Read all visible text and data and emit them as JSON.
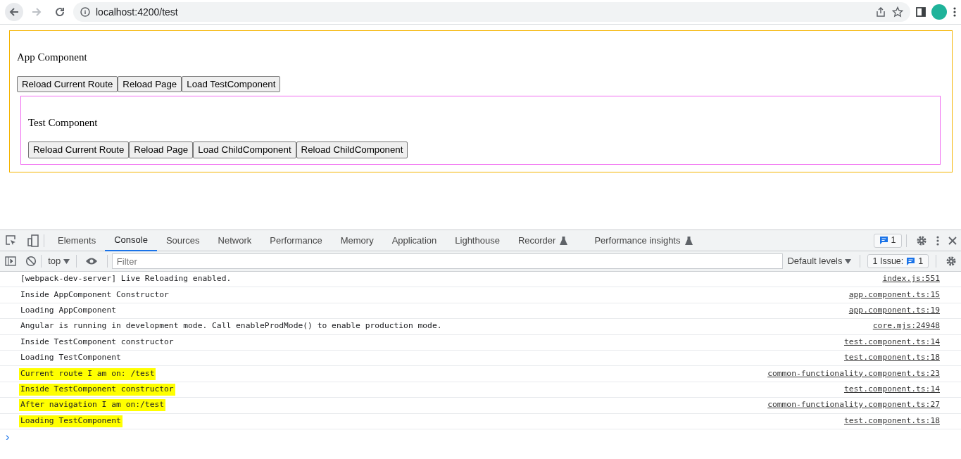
{
  "browser": {
    "url": "localhost:4200/test"
  },
  "app": {
    "title": "App Component",
    "buttons": [
      "Reload Current Route",
      "Reload Page",
      "Load TestComponent"
    ],
    "test": {
      "title": "Test Component",
      "buttons": [
        "Reload Current Route",
        "Reload Page",
        "Load ChildComponent",
        "Reload ChildComponent"
      ]
    }
  },
  "devtools": {
    "tabs": [
      {
        "label": "Elements",
        "selected": false,
        "experimental": false
      },
      {
        "label": "Console",
        "selected": true,
        "experimental": false
      },
      {
        "label": "Sources",
        "selected": false,
        "experimental": false
      },
      {
        "label": "Network",
        "selected": false,
        "experimental": false
      },
      {
        "label": "Performance",
        "selected": false,
        "experimental": false
      },
      {
        "label": "Memory",
        "selected": false,
        "experimental": false
      },
      {
        "label": "Application",
        "selected": false,
        "experimental": false
      },
      {
        "label": "Lighthouse",
        "selected": false,
        "experimental": false
      },
      {
        "label": "Recorder",
        "selected": false,
        "experimental": true
      },
      {
        "label": "Performance insights",
        "selected": false,
        "experimental": true
      }
    ],
    "messages_count": "1",
    "toolbar": {
      "context": "top",
      "filter_placeholder": "Filter",
      "levels": "Default levels",
      "issues_label": "1 Issue:",
      "issues_count": "1"
    },
    "rows": [
      {
        "message": "[webpack-dev-server] Live Reloading enabled.",
        "source": "index.js:551",
        "highlighted": false
      },
      {
        "message": "Inside AppComponent Constructor",
        "source": "app.component.ts:15",
        "highlighted": false
      },
      {
        "message": "Loading AppComponent",
        "source": "app.component.ts:19",
        "highlighted": false
      },
      {
        "message": "Angular is running in development mode. Call enableProdMode() to enable production mode.",
        "source": "core.mjs:24948",
        "highlighted": false
      },
      {
        "message": "Inside TestComponent constructor",
        "source": "test.component.ts:14",
        "highlighted": false
      },
      {
        "message": "Loading TestComponent",
        "source": "test.component.ts:18",
        "highlighted": false
      },
      {
        "message": "Current route I am on: /test",
        "source": "common-functionality.component.ts:23",
        "highlighted": true
      },
      {
        "message": "Inside TestComponent constructor",
        "source": "test.component.ts:14",
        "highlighted": true
      },
      {
        "message": "After navigation I am on:/test",
        "source": "common-functionality.component.ts:27",
        "highlighted": true
      },
      {
        "message": "Loading TestComponent",
        "source": "test.component.ts:18",
        "highlighted": true
      }
    ],
    "prompt": "›"
  }
}
